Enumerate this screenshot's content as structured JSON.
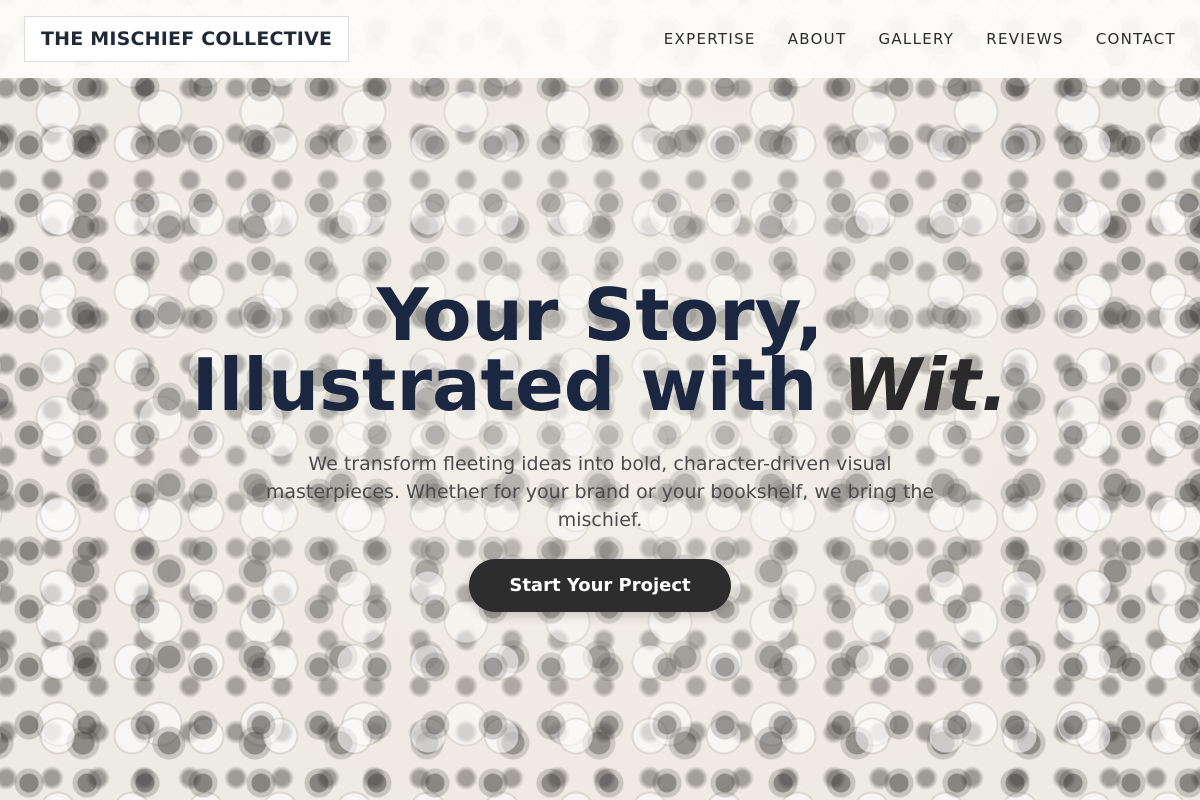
{
  "brand": {
    "name": "THE MISCHIEF COLLECTIVE"
  },
  "nav": {
    "items": [
      "EXPERTISE",
      "ABOUT",
      "GALLERY",
      "REVIEWS",
      "CONTACT"
    ]
  },
  "hero": {
    "title_line1": "Your Story,",
    "title_line2_main": "Illustrated with ",
    "title_line2_accent": "Wit.",
    "subtitle": "We transform fleeting ideas into bold, character-driven visual masterpieces. Whether for your brand or your bookshelf, we bring the mischief.",
    "cta_label": "Start Your Project"
  },
  "colors": {
    "title": "#1b2640",
    "cta_background": "#2d2d2d",
    "header_background": "#fdfcfa"
  }
}
